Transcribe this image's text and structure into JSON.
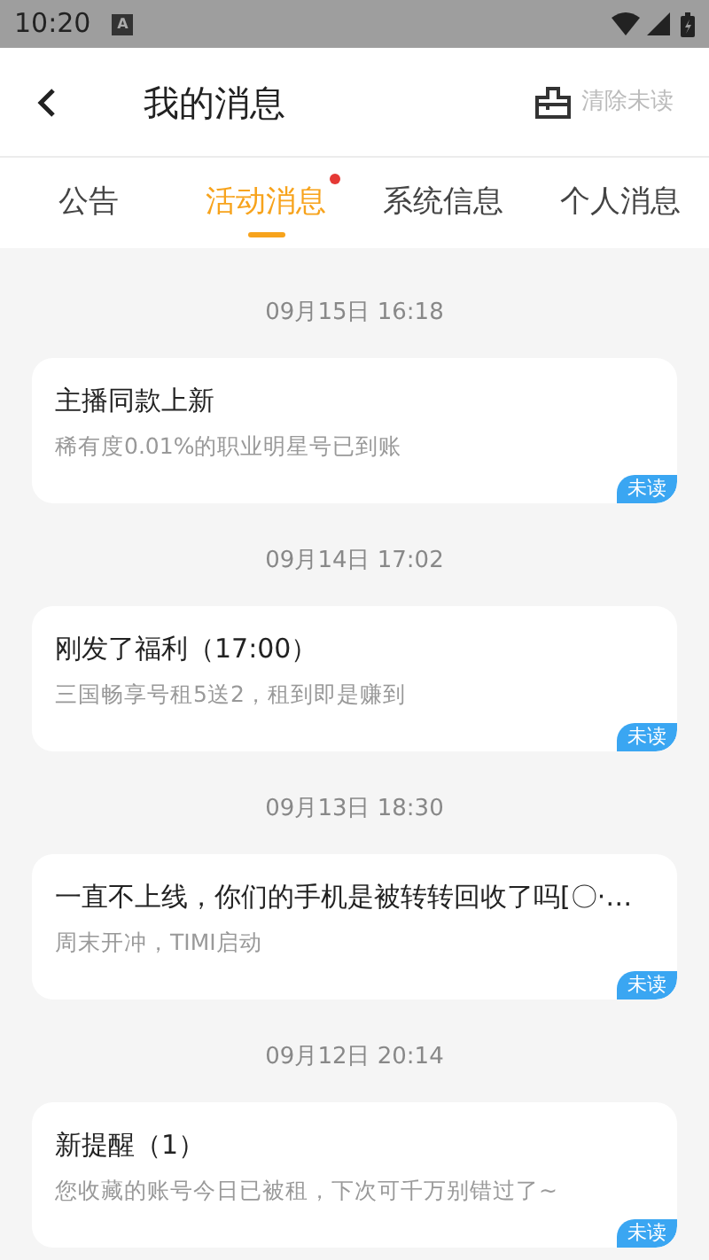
{
  "status_bar": {
    "time": "10:20",
    "notification": "A"
  },
  "header": {
    "title": "我的消息",
    "action": "清除未读"
  },
  "tabs": [
    {
      "label": "公告",
      "selected": false,
      "dot": false
    },
    {
      "label": "活动消息",
      "selected": true,
      "dot": true
    },
    {
      "label": "系统信息",
      "selected": false,
      "dot": false
    },
    {
      "label": "个人消息",
      "selected": false,
      "dot": false
    }
  ],
  "messages": [
    {
      "date": "09月15日 16:18",
      "title": "主播同款上新",
      "body": "稀有度0.01%的职业明星号已到账",
      "badge": "未读"
    },
    {
      "date": "09月14日 17:02",
      "title": "刚发了福利（17:00）",
      "body": "三国畅享号租5送2，租到即是赚到",
      "badge": "未读"
    },
    {
      "date": "09月13日 18:30",
      "title": "一直不上线，你们的手机是被转转回收了吗[〇·…",
      "body": "周末开冲，TIMI启动",
      "badge": "未读"
    },
    {
      "date": "09月12日 20:14",
      "title": "新提醒（1）",
      "body": "您收藏的账号今日已被租，下次可千万别错过了~",
      "badge": "未读"
    }
  ]
}
